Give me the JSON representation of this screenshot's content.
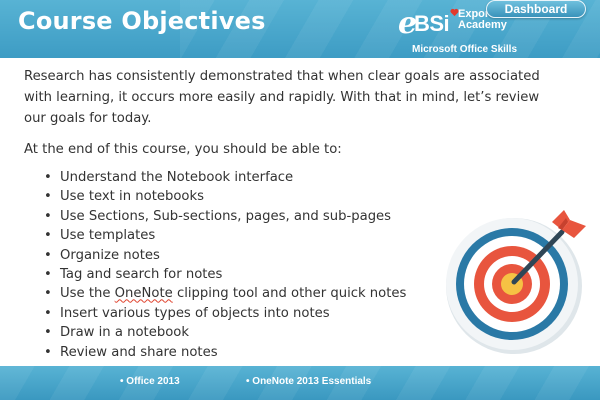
{
  "header": {
    "title": "Course Objectives",
    "dashboard_label": "Dashboard",
    "logo": {
      "letter_e": "e",
      "letters_bsi": "BSi",
      "line1": "Export",
      "line2": "Academy"
    },
    "subtitle": "Microsoft Office Skills"
  },
  "content": {
    "intro": "Research has consistently demonstrated that when clear goals are associated with learning, it occurs more easily and rapidly. With that in mind, let’s review our goals for today.",
    "lead": "At the end of this course, you should be able to:",
    "objectives": [
      "Understand the Notebook interface",
      "Use text in notebooks",
      "Use Sections, Sub-sections, pages, and sub-pages",
      "Use templates",
      "Organize notes",
      "Tag and search for notes",
      "Use the OneNote clipping tool and other quick notes",
      "Insert various types of objects into notes",
      "Draw in a notebook",
      "Review and share notes"
    ],
    "bullet": "•"
  },
  "footer": {
    "item1": "Office 2013",
    "item2": "OneNote 2013 Essentials",
    "bullet": "•"
  },
  "colors": {
    "header_blue": "#4aa8cc",
    "target_red": "#e8553e",
    "target_yellow": "#f6c244",
    "target_blue": "#2a79a6"
  },
  "icons": {
    "target": "target-icon",
    "heart": "heart-icon"
  }
}
